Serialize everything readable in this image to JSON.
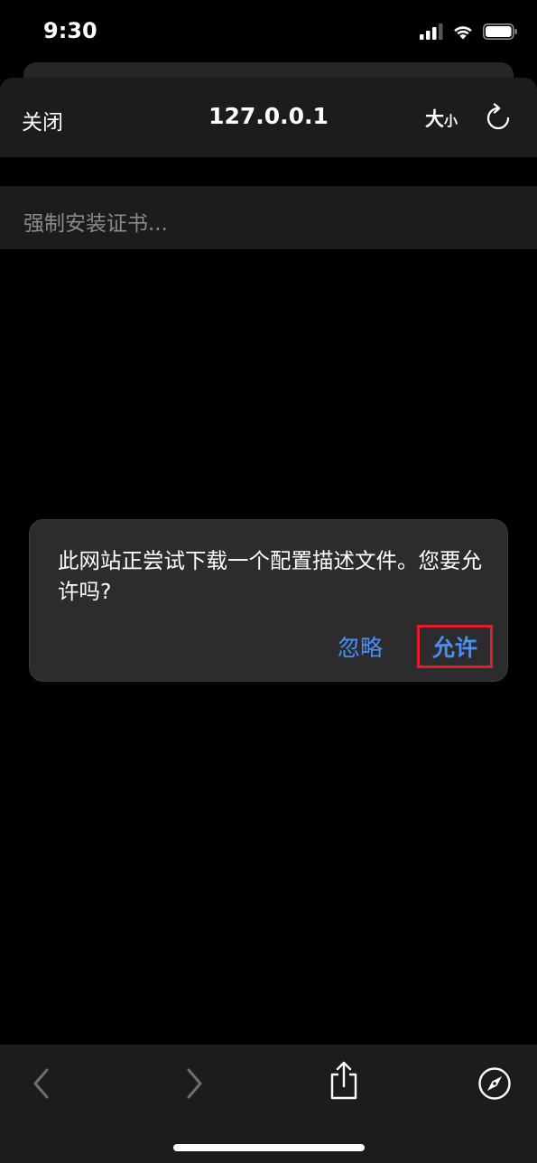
{
  "status_bar": {
    "time": "9:30",
    "icons": [
      "cellular-signal-icon",
      "wifi-icon",
      "battery-icon"
    ]
  },
  "header": {
    "close_label": "关闭",
    "url": "127.0.0.1",
    "text_size_big": "大",
    "text_size_small": "小",
    "reload_icon": "reload-icon"
  },
  "page": {
    "content_text": "强制安装证书..."
  },
  "alert": {
    "message": "此网站正尝试下载一个配置描述文件。您要允许吗?",
    "ignore_label": "忽略",
    "allow_label": "允许",
    "highlight_color": "#e01e2a",
    "action_color": "#4a8ff7"
  },
  "toolbar": {
    "icons": [
      "back-arrow-icon",
      "forward-arrow-icon",
      "share-icon",
      "compass-icon"
    ]
  }
}
